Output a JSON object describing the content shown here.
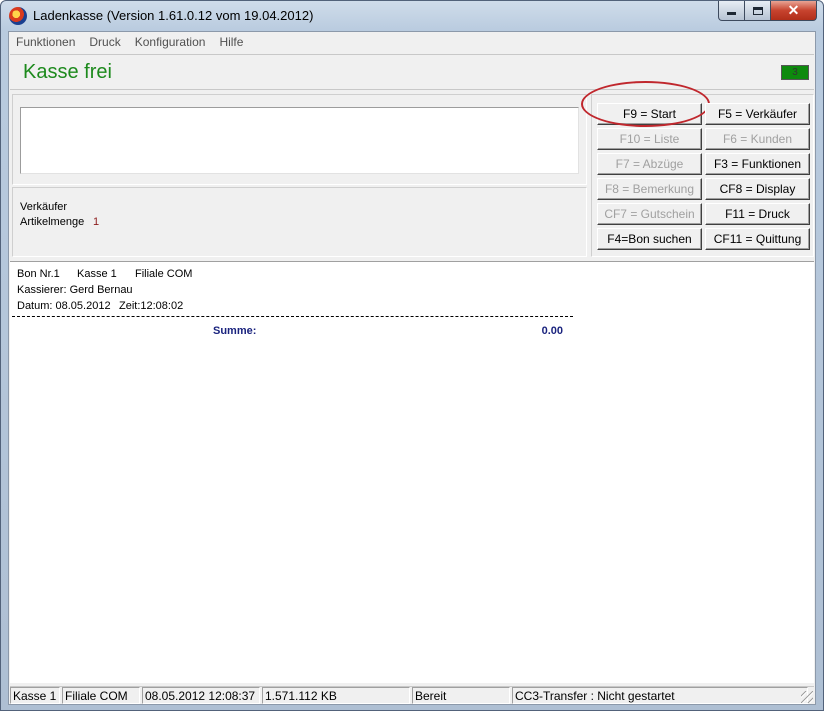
{
  "window": {
    "title": "Ladenkasse (Version 1.61.0.12 vom 19.04.2012)",
    "close_glyph": "✕"
  },
  "menu": [
    "Funktionen",
    "Druck",
    "Konfiguration",
    "Hilfe"
  ],
  "header": {
    "status": "Kasse frei",
    "counter": "3"
  },
  "info": {
    "seller_label": "Verkäufer",
    "seller_value": "",
    "qty_label": "Artikelmenge",
    "qty_value": "1"
  },
  "buttons": {
    "f9": "F9 = Start",
    "f5": "F5 = Verkäufer",
    "f10": "F10 = Liste",
    "f6": "F6 = Kunden",
    "f7": "F7 = Abzüge",
    "f3": "F3 = Funktionen",
    "f8": "F8 = Bemerkung",
    "cf8": "CF8 = Display",
    "cf7": "CF7 = Gutschein",
    "f11": "F11 = Druck",
    "f4": "F4=Bon suchen",
    "cf11": "CF11 = Quittung"
  },
  "receipt": {
    "bon_nr": "Bon Nr.1",
    "kasse": "Kasse 1",
    "filiale": "Filiale COM",
    "kassierer": "Kassierer: Gerd Bernau",
    "datum": "Datum: 08.05.2012",
    "zeit": "Zeit:12:08:02",
    "sum_label": "Summe:",
    "sum_value": "0.00"
  },
  "statusbar": [
    "Kasse 1",
    "Filiale COM",
    "08.05.2012   12:08:37",
    "1.571.112 KB",
    "Bereit",
    "CC3-Transfer : Nicht gestartet"
  ],
  "colors": {
    "status_green": "#1d8a1d",
    "sum_blue": "#1a237e",
    "highlight_red": "#c0272d"
  }
}
